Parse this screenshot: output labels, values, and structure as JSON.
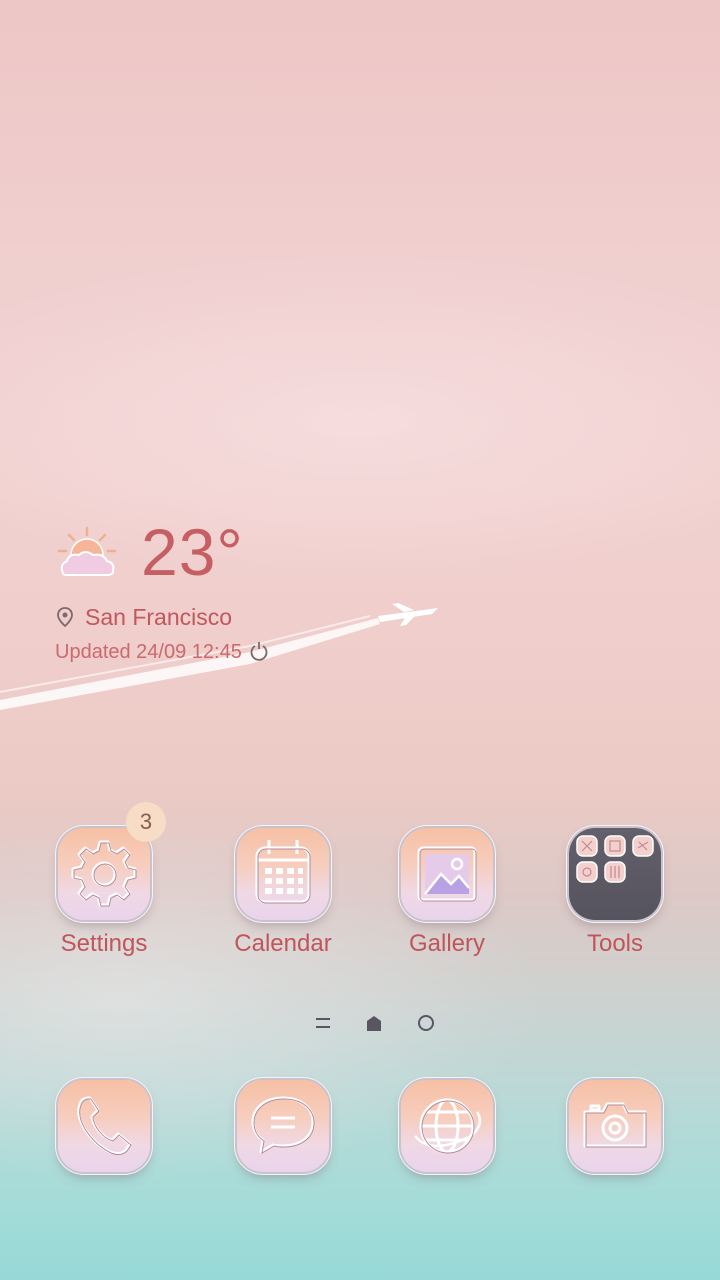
{
  "weather": {
    "temperature": "23°",
    "icon": "partly-cloudy-sun-icon",
    "location": "San Francisco",
    "updated": "Updated 24/09 12:45"
  },
  "apps": [
    {
      "label": "Settings",
      "icon": "gear-icon",
      "badge": "3"
    },
    {
      "label": "Calendar",
      "icon": "calendar-icon"
    },
    {
      "label": "Gallery",
      "icon": "image-icon"
    },
    {
      "label": "Tools",
      "icon": "folder-icon"
    }
  ],
  "dock": [
    {
      "icon": "phone-icon"
    },
    {
      "icon": "message-icon"
    },
    {
      "icon": "globe-icon"
    },
    {
      "icon": "camera-icon"
    }
  ],
  "pager": {
    "current": "home"
  },
  "colors": {
    "accent_text": "#c0555a",
    "tile_gradient_top": "#f6c0a4",
    "tile_gradient_bottom": "#e9d4ec",
    "wallpaper_top": "#edc6c5",
    "wallpaper_bottom": "#96d9d6"
  }
}
